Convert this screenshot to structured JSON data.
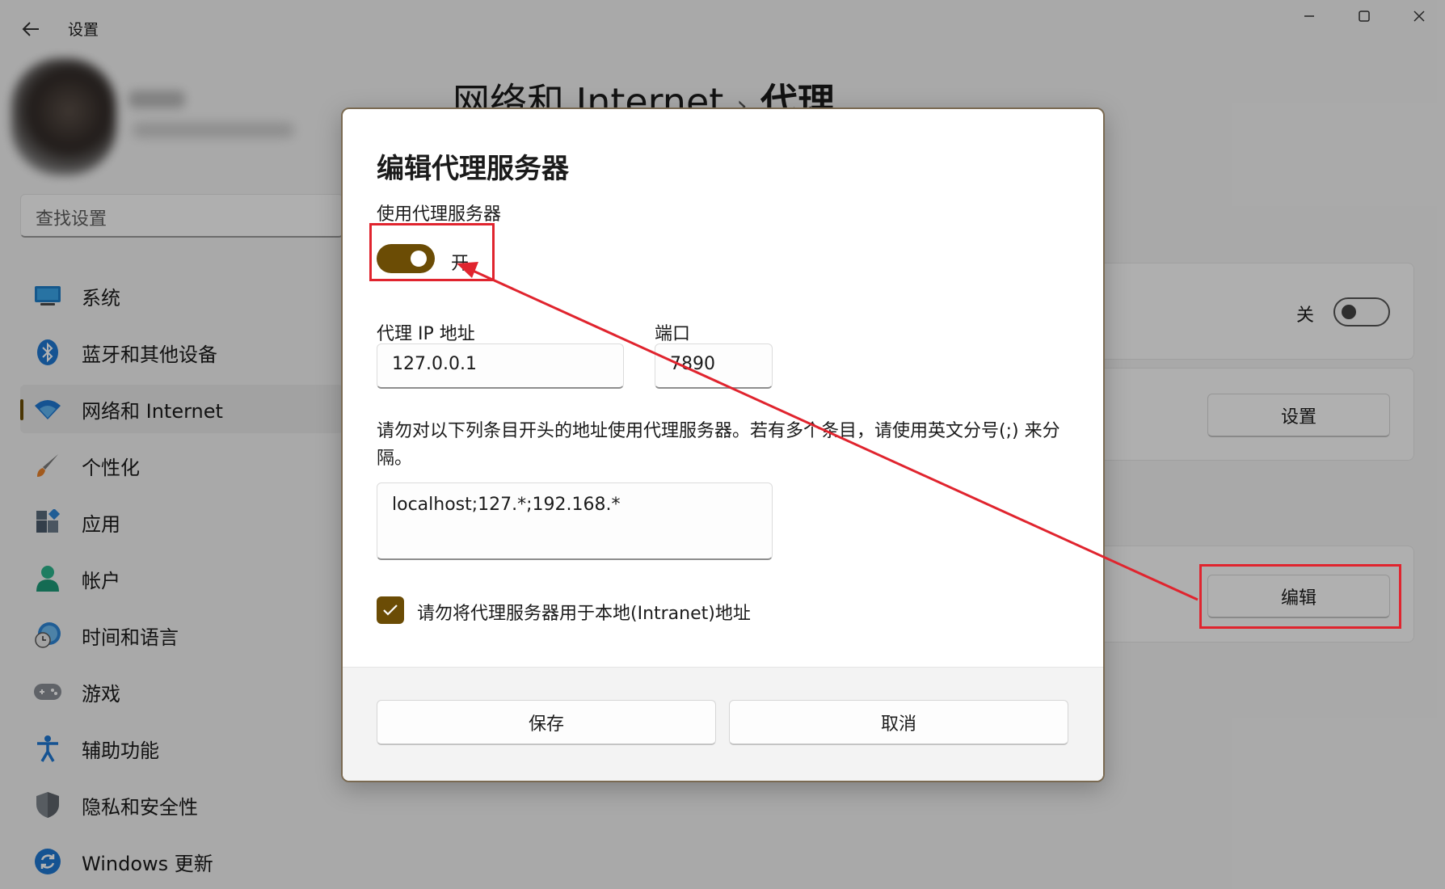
{
  "window": {
    "title": "设置",
    "controls": {
      "minimize": "—",
      "maximize": "▢",
      "close": "✕"
    }
  },
  "search": {
    "placeholder": "查找设置"
  },
  "sidebar": {
    "items": [
      {
        "label": "系统",
        "icon": "system-icon"
      },
      {
        "label": "蓝牙和其他设备",
        "icon": "bluetooth-icon"
      },
      {
        "label": "网络和 Internet",
        "icon": "wifi-icon",
        "active": true
      },
      {
        "label": "个性化",
        "icon": "brush-icon"
      },
      {
        "label": "应用",
        "icon": "apps-icon"
      },
      {
        "label": "帐户",
        "icon": "account-icon"
      },
      {
        "label": "时间和语言",
        "icon": "time-language-icon"
      },
      {
        "label": "游戏",
        "icon": "gamepad-icon"
      },
      {
        "label": "辅助功能",
        "icon": "accessibility-icon"
      },
      {
        "label": "隐私和安全性",
        "icon": "shield-icon"
      },
      {
        "label": "Windows 更新",
        "icon": "update-icon"
      }
    ]
  },
  "breadcrumb": {
    "parent": "网络和 Internet",
    "separator": "›",
    "current": "代理"
  },
  "background_cards": {
    "auto_detect_state": "关",
    "setup_script_button": "设置",
    "manual_edit_button": "编辑"
  },
  "dialog": {
    "title": "编辑代理服务器",
    "use_proxy_label": "使用代理服务器",
    "use_proxy_state": "开",
    "ip_label": "代理 IP 地址",
    "ip_value": "127.0.0.1",
    "port_label": "端口",
    "port_value": "7890",
    "exceptions_description": "请勿对以下列条目开头的地址使用代理服务器。若有多个条目，请使用英文分号(;) 来分隔。",
    "exceptions_value": "localhost;127.*;192.168.*",
    "bypass_local_label": "请勿将代理服务器用于本地(Intranet)地址",
    "bypass_local_checked": true,
    "save_label": "保存",
    "cancel_label": "取消"
  },
  "colors": {
    "accent": "#6b4c05",
    "annotation": "#e0242e"
  }
}
